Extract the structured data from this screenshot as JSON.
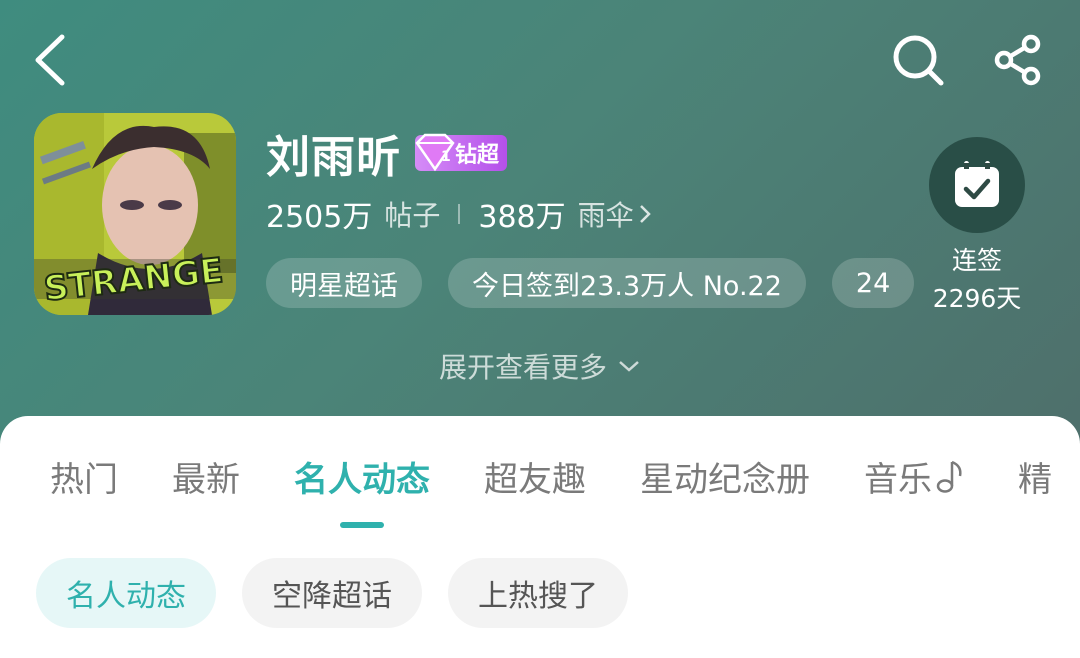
{
  "colors": {
    "accent": "#2fb1ad",
    "header_bg": "#48877b",
    "badge": "#c06ef0"
  },
  "header": {
    "back_icon": "chevron-left-icon",
    "search_icon": "search-icon",
    "share_icon": "share-icon"
  },
  "profile": {
    "name": "刘雨昕",
    "badge_label": "钻超",
    "avatar_text": "STRANGE",
    "stats": {
      "posts_value": "2505万",
      "posts_label": "帖子",
      "fans_value": "388万",
      "fans_label": "雨伞"
    },
    "tags": [
      "明星超话",
      "今日签到23.3万人 No.22",
      "24"
    ]
  },
  "checkin": {
    "label": "连签",
    "days": "2296天"
  },
  "expand_label": "展开查看更多",
  "tabs": [
    {
      "label": "热门"
    },
    {
      "label": "最新"
    },
    {
      "label": "名人动态",
      "active": true
    },
    {
      "label": "超友趣"
    },
    {
      "label": "星动纪念册"
    },
    {
      "label": "音乐"
    },
    {
      "label": "精"
    }
  ],
  "chips": [
    {
      "label": "名人动态",
      "active": true
    },
    {
      "label": "空降超话"
    },
    {
      "label": "上热搜了"
    }
  ]
}
